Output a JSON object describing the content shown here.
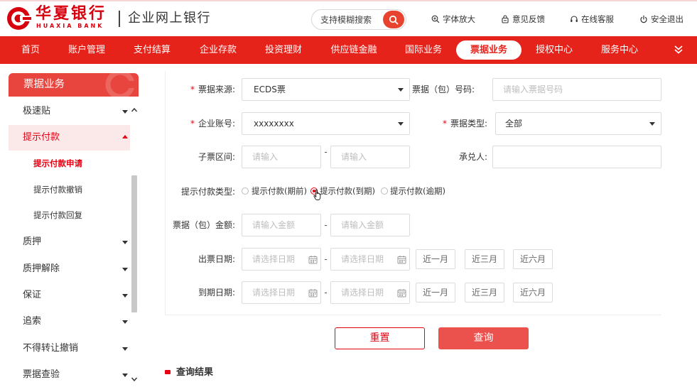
{
  "header": {
    "bank_name": "华夏银行",
    "bank_name_en": "HUAXIA BANK",
    "product_name": "企业网上银行",
    "search": {
      "placeholder": "支持模糊搜索",
      "icon": "search-icon"
    },
    "links": [
      {
        "label": "字体放大",
        "icon": "zoom-in-icon"
      },
      {
        "label": "意见反馈",
        "icon": "feedback-icon"
      },
      {
        "label": "在线客服",
        "icon": "headset-icon"
      },
      {
        "label": "安全退出",
        "icon": "power-icon"
      }
    ]
  },
  "nav": {
    "items": [
      "首页",
      "账户管理",
      "支付结算",
      "企业存款",
      "投资理财",
      "供应链金融",
      "国际业务",
      "票据业务",
      "授权中心",
      "服务中心"
    ],
    "active_index": 7,
    "more_icon": "double-chevron-down-icon"
  },
  "sidebar": {
    "title": "票据业务",
    "items": [
      {
        "label": "极速贴",
        "expanded": false
      },
      {
        "label": "提示付款",
        "expanded": true,
        "children": [
          {
            "label": "提示付款申请",
            "active": true
          },
          {
            "label": "提示付款撤销",
            "active": false
          },
          {
            "label": "提示付款回复",
            "active": false
          }
        ]
      },
      {
        "label": "质押",
        "expanded": false
      },
      {
        "label": "质押解除",
        "expanded": false
      },
      {
        "label": "保证",
        "expanded": false
      },
      {
        "label": "追索",
        "expanded": false
      },
      {
        "label": "不得转让撤销",
        "expanded": false
      },
      {
        "label": "票据查验",
        "expanded": false
      }
    ]
  },
  "form": {
    "required_mark": "*",
    "range_separator": "-",
    "bill_source": {
      "label": "票据来源:",
      "required": true,
      "value": "ECDS票"
    },
    "bill_number": {
      "label": "票据（包）号码:",
      "placeholder": "请输入票据号码"
    },
    "account": {
      "label": "企业账号:",
      "required": true,
      "value": "xxxxxxxx"
    },
    "bill_type": {
      "label": "票据类型:",
      "required": true,
      "value": "全部"
    },
    "sub_range": {
      "label": "子票区间:",
      "from_placeholder": "请输入",
      "to_placeholder": "请输入"
    },
    "acceptor": {
      "label": "承兑人:",
      "value": ""
    },
    "payment_type": {
      "label": "提示付款类型:",
      "options": [
        "提示付款(期前)",
        "提示付款(到期)",
        "提示付款(逾期)"
      ],
      "selected_index": 1
    },
    "amount": {
      "label": "票据（包）金额:",
      "from_placeholder": "请输入金额",
      "to_placeholder": "请输入金额"
    },
    "issue_date": {
      "label": "出票日期:",
      "from_placeholder": "请选择日期",
      "to_placeholder": "请选择日期",
      "quick_ranges": [
        "近一月",
        "近三月",
        "近六月"
      ]
    },
    "due_date": {
      "label": "到期日期:",
      "from_placeholder": "请选择日期",
      "to_placeholder": "请选择日期",
      "quick_ranges": [
        "近一月",
        "近三月",
        "近六月"
      ]
    },
    "buttons": {
      "reset": "重置",
      "query": "查询"
    }
  },
  "results": {
    "title": "查询结果"
  },
  "colors": {
    "brand_red": "#e60012",
    "nav_red": "#e5231b",
    "button_red": "#eb524d",
    "active_bg": "#fbe8e8",
    "scroll_thumb": "#c8c8c8"
  }
}
